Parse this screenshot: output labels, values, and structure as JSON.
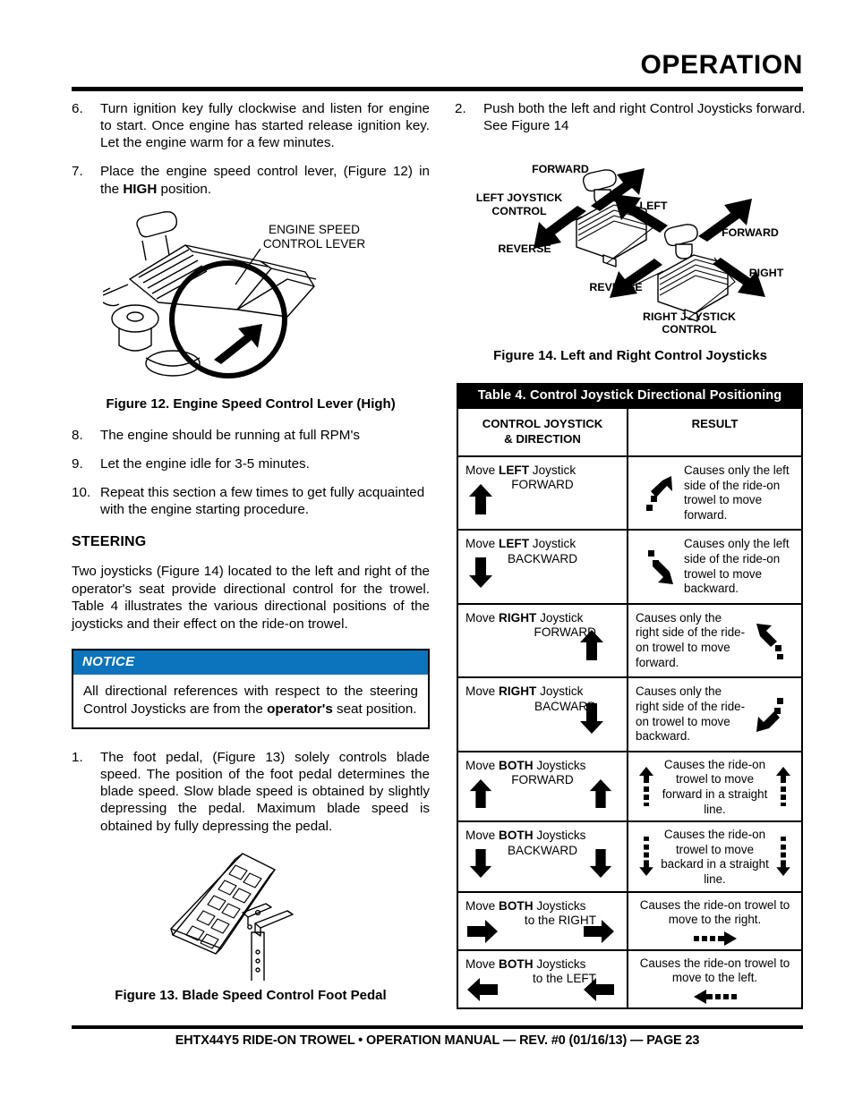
{
  "header": {
    "title": "OPERATION"
  },
  "left_column": {
    "steps": [
      {
        "num": "6.",
        "text": "Turn ignition key fully clockwise and listen for engine to start. Once engine has started release ignition key. Let the engine warm for a few minutes."
      },
      {
        "num": "7.",
        "pre": "Place the engine speed control lever, (Figure 12) in the ",
        "bold": "HIGH",
        "post": " position."
      }
    ],
    "figure12": {
      "callout_line1": "ENGINE SPEED",
      "callout_line2": "CONTROL LEVER",
      "caption": "Figure 12. Engine Speed Control Lever (High)"
    },
    "steps2": [
      {
        "num": "8.",
        "text": "The engine should be running at full RPM's"
      },
      {
        "num": "9.",
        "text": "Let the engine idle for 3-5 minutes."
      },
      {
        "num": "10.",
        "text": "Repeat this section a few times to get fully acquainted with the engine starting procedure."
      }
    ],
    "steering": {
      "heading": "STEERING",
      "paragraph": "Two joysticks (Figure 14) located to the left and right of the operator's seat provide directional control for the trowel. Table 4 illustrates the various directional positions of the joysticks and their effect on the ride-on trowel."
    },
    "notice": {
      "label": "NOTICE",
      "pre": "All directional references with respect to the steering Control Joysticks are from the ",
      "bold": "operator's",
      "post": " seat position."
    },
    "step_pedal": {
      "num": "1.",
      "text": "The foot pedal, (Figure 13) solely controls blade speed. The position of the foot pedal determines the blade speed. Slow blade speed is obtained by slightly depressing the pedal. Maximum blade speed is obtained by fully depressing the pedal."
    },
    "figure13": {
      "caption": "Figure 13. Blade Speed Control Foot Pedal"
    }
  },
  "right_column": {
    "steps": [
      {
        "num": "2.",
        "text": "Push both the left and right Control Joysticks forward. See Figure 14"
      }
    ],
    "figure14": {
      "labels": {
        "forward_left": "FORWARD",
        "left_joystick_1": "LEFT JOYSTICK",
        "left_joystick_2": "CONTROL",
        "reverse_left": "REVERSE",
        "left": "LEFT",
        "forward_right": "FORWARD",
        "right": "RIGHT",
        "reverse_right": "REVERSE",
        "right_joystick_1": "RIGHT JOYSTICK",
        "right_joystick_2": "CONTROL"
      },
      "caption": "Figure 14. Left and Right Control Joysticks"
    }
  },
  "table4": {
    "title": "Table 4. Control Joystick Directional Positioning",
    "headers": {
      "col1_line1": "CONTROL JOYSTICK",
      "col1_line2": "& DIRECTION",
      "col2": "RESULT"
    },
    "rows": [
      {
        "action_pre": "Move ",
        "action_bold": "LEFT",
        "action_post": " Joystick",
        "action_line2": "FORWARD",
        "action_icon": "arrow-up-left",
        "action_icon_side": "left",
        "result": "Causes only the left side of the ride-on trowel to move forward.",
        "result_icon": "dotted-arrow-up-right",
        "result_icon_side": "left"
      },
      {
        "action_pre": "Move ",
        "action_bold": "LEFT",
        "action_post": " Joystick",
        "action_line2": "BACKWARD",
        "action_icon": "arrow-down-left",
        "action_icon_side": "left",
        "result": "Causes only the left side of the ride-on trowel to move backward.",
        "result_icon": "dotted-arrow-down-right",
        "result_icon_side": "left"
      },
      {
        "action_pre": "Move ",
        "action_bold": "RIGHT",
        "action_post": " Joystick",
        "action_line2": "FORWARD",
        "action_icon": "arrow-up-right",
        "action_icon_side": "right",
        "result": "Causes only the right side of the ride-on trowel to move forward.",
        "result_icon": "dotted-arrow-up-left",
        "result_icon_side": "right"
      },
      {
        "action_pre": "Move ",
        "action_bold": "RIGHT",
        "action_post": " Joystick",
        "action_line2": "BACWARD",
        "action_icon": "arrow-down-right",
        "action_icon_side": "right",
        "result": "Causes only the right side of the ride-on trowel to move backward.",
        "result_icon": "dotted-arrow-down-left",
        "result_icon_side": "right"
      },
      {
        "action_pre": "Move ",
        "action_bold": "BOTH",
        "action_post": " Joysticks",
        "action_line2": "FORWARD",
        "action_icon": "arrow-up-pair",
        "action_icon_side": "both",
        "result": "Causes the ride-on trowel to move forward in a straight line.",
        "result_icon": "dotted-arrow-up-pair",
        "result_icon_side": "both"
      },
      {
        "action_pre": "Move ",
        "action_bold": "BOTH",
        "action_post": " Joysticks",
        "action_line2": "BACKWARD",
        "action_icon": "arrow-down-pair",
        "action_icon_side": "both",
        "result": "Causes the ride-on trowel to move backard in a straight line.",
        "result_icon": "dotted-arrow-down-pair",
        "result_icon_side": "both"
      },
      {
        "action_pre": "Move ",
        "action_bold": "BOTH",
        "action_post": " Joysticks",
        "action_line2": "to the RIGHT",
        "action_icon": "arrow-right-pair",
        "action_icon_side": "both",
        "result": "Causes the ride-on trowel to move to the right.",
        "result_icon": "dotted-arrow-right",
        "result_icon_side": "center"
      },
      {
        "action_pre": "Move ",
        "action_bold": "BOTH",
        "action_post": " Joysticks",
        "action_line2": "to the LEFT",
        "action_icon": "arrow-left-pair",
        "action_icon_side": "both",
        "result": "Causes the ride-on trowel to move to the left.",
        "result_icon": "dotted-arrow-left",
        "result_icon_side": "center"
      }
    ]
  },
  "footer": {
    "text": "EHTX44Y5 RIDE-ON TROWEL • OPERATION MANUAL — REV. #0 (01/16/13) — PAGE 23"
  },
  "colors": {
    "notice_bar": "#0b74bc",
    "rule": "#000000",
    "table_title_bg": "#000000"
  }
}
